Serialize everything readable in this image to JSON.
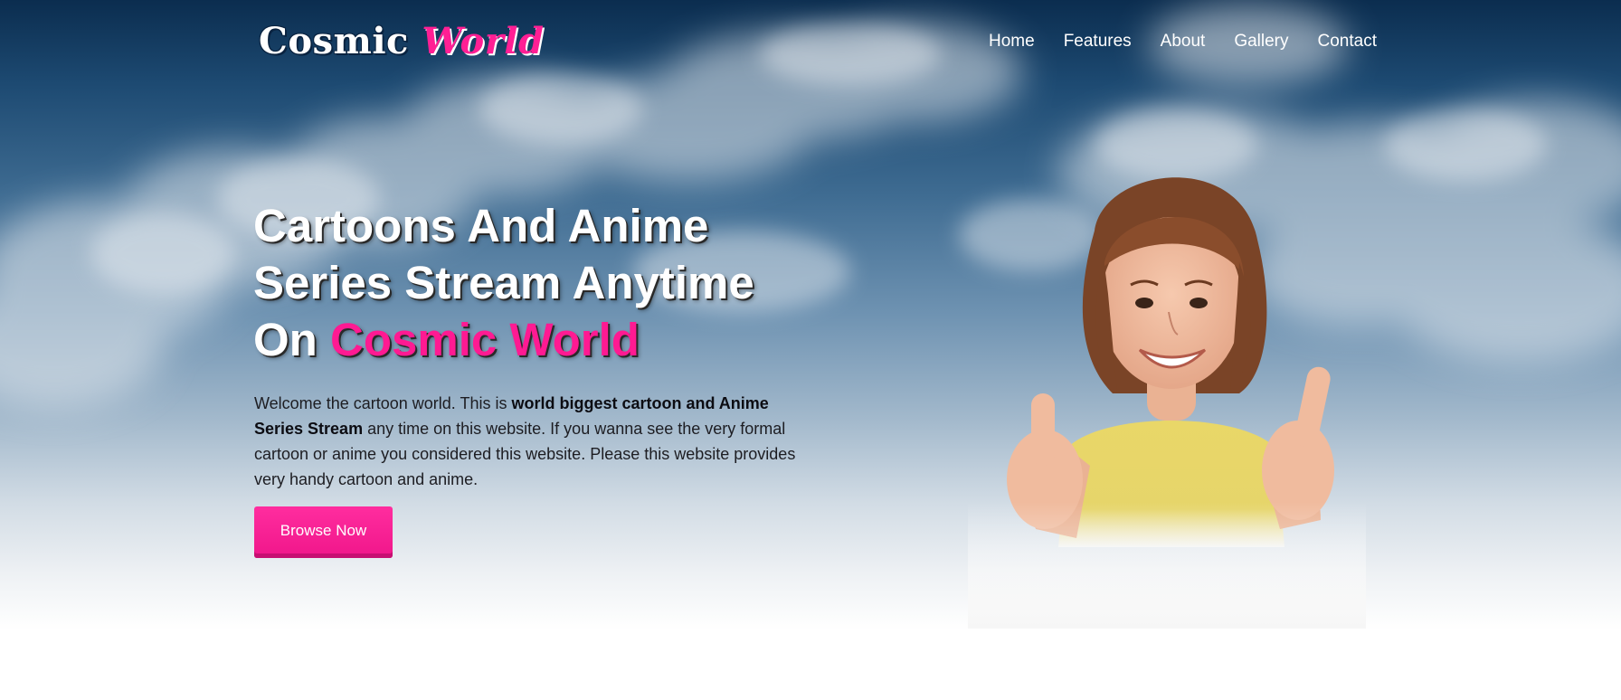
{
  "logo": {
    "word1": "Cosmic",
    "word2": "World"
  },
  "nav": {
    "items": [
      "Home",
      "Features",
      "About",
      "Gallery",
      "Contact"
    ]
  },
  "hero": {
    "headline_line1": "Cartoons And Anime",
    "headline_line2": "Series Stream Anytime",
    "headline_line3_prefix": "On",
    "headline_line3_highlight": "Cosmic World",
    "description": {
      "part1": "Welcome the cartoon world. This is ",
      "bold": "world biggest cartoon and Anime Series Stream",
      "part2": " any time on this website. If you wanna see the very formal cartoon or anime you considered this website. Please this website provides very handy cartoon and anime."
    },
    "cta_label": "Browse Now"
  },
  "colors": {
    "accent": "#ff1a92",
    "sky_top": "#0b2d4f",
    "text_dark": "#1d1d22"
  }
}
